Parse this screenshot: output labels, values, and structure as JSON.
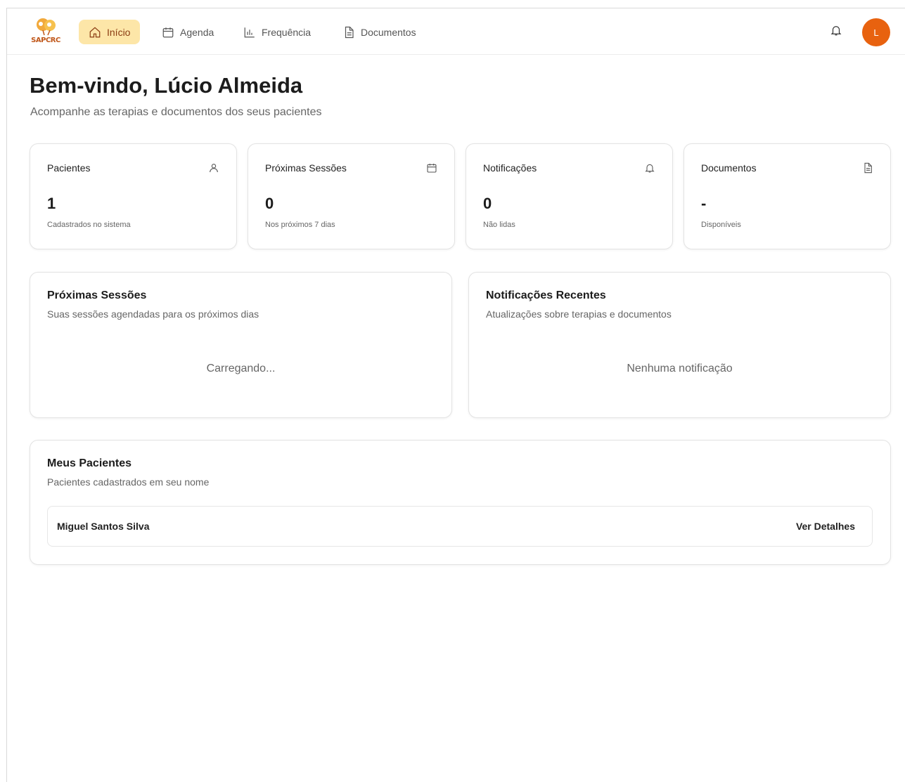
{
  "app": {
    "logo_text": "SAPCRC",
    "accent_color": "#e8620f",
    "active_nav_bg": "#fde6a8"
  },
  "nav": {
    "items": [
      {
        "label": "Início",
        "icon": "home-icon",
        "active": true
      },
      {
        "label": "Agenda",
        "icon": "calendar-icon",
        "active": false
      },
      {
        "label": "Frequência",
        "icon": "bar-chart-icon",
        "active": false
      },
      {
        "label": "Documentos",
        "icon": "document-icon",
        "active": false
      }
    ],
    "avatar_initial": "L"
  },
  "header": {
    "title": "Bem-vindo, Lúcio Almeida",
    "subtitle": "Acompanhe as terapias e documentos dos seus pacientes"
  },
  "stats": [
    {
      "label": "Pacientes",
      "icon": "user-icon",
      "value": "1",
      "note": "Cadastrados no sistema"
    },
    {
      "label": "Próximas Sessões",
      "icon": "calendar-icon",
      "value": "0",
      "note": "Nos próximos 7 dias"
    },
    {
      "label": "Notificações",
      "icon": "bell-icon",
      "value": "0",
      "note": "Não lidas"
    },
    {
      "label": "Documentos",
      "icon": "document-icon",
      "value": "-",
      "note": "Disponíveis"
    }
  ],
  "sessions_panel": {
    "title": "Próximas Sessões",
    "subtitle": "Suas sessões agendadas para os próximos dias",
    "status": "Carregando..."
  },
  "notifications_panel": {
    "title": "Notificações Recentes",
    "subtitle": "Atualizações sobre terapias e documentos",
    "empty": "Nenhuma notificação"
  },
  "patients_panel": {
    "title": "Meus Pacientes",
    "subtitle": "Pacientes cadastrados em seu nome",
    "patients": [
      {
        "name": "Miguel Santos Silva",
        "action": "Ver Detalhes"
      }
    ]
  }
}
